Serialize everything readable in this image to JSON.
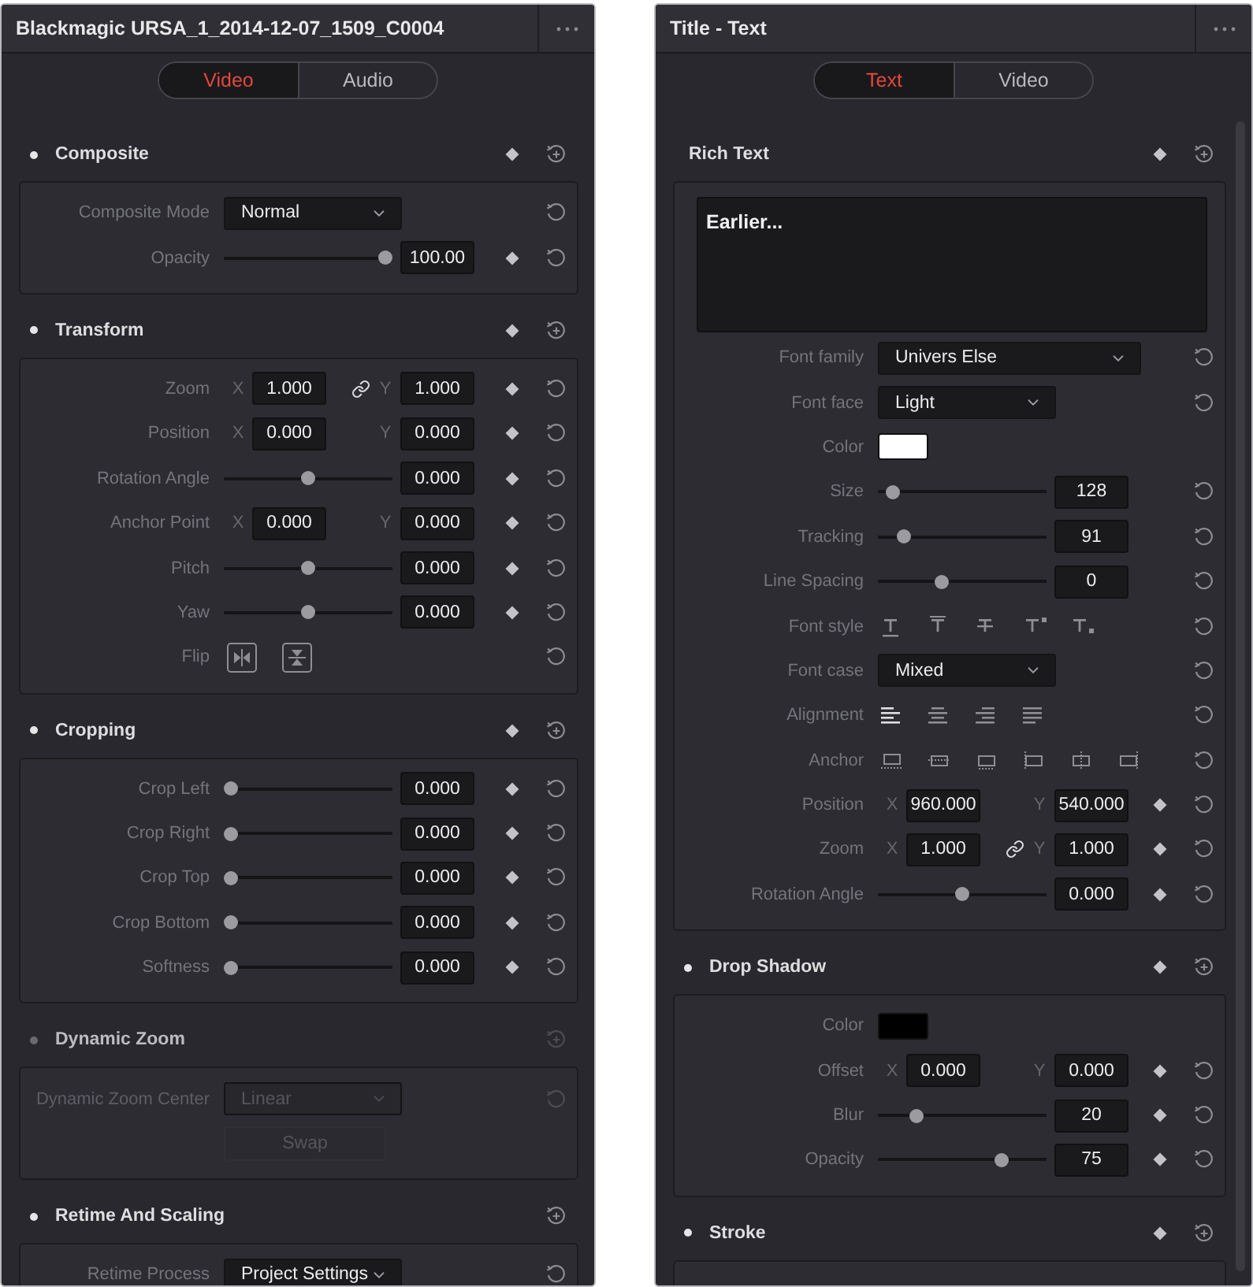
{
  "panels": [
    {
      "title": "Blackmagic URSA_1_2014-12-07_1509_C0004",
      "tabs": [
        {
          "label": "Video",
          "selected": true
        },
        {
          "label": "Audio",
          "selected": false
        }
      ],
      "sections": [
        {
          "title": "Composite",
          "dot": true,
          "enabled": true,
          "keyframe": true,
          "rows": [
            {
              "kind": "dropdown",
              "label": "Composite Mode",
              "value": "Normal",
              "wide": false,
              "keyframe": false,
              "reset": true
            },
            {
              "kind": "slider",
              "label": "Opacity",
              "level": 1,
              "value": "100.00",
              "keyframe": true,
              "reset": true
            }
          ]
        },
        {
          "title": "Transform",
          "dot": true,
          "enabled": true,
          "keyframe": true,
          "rows": [
            {
              "kind": "xy",
              "label": "Zoom",
              "x": {
                "axis": "X",
                "value": "1.000"
              },
              "y": {
                "axis": "Y",
                "value": "1.000"
              },
              "linked": true,
              "keyframe": true,
              "reset": true
            },
            {
              "kind": "xy",
              "label": "Position",
              "x": {
                "axis": "X",
                "value": "0.000"
              },
              "y": {
                "axis": "Y",
                "value": "0.000"
              },
              "linked": false,
              "keyframe": true,
              "reset": true
            },
            {
              "kind": "slider",
              "label": "Rotation Angle",
              "level": 0.5,
              "value": "0.000",
              "keyframe": true,
              "reset": true
            },
            {
              "kind": "xy",
              "label": "Anchor Point",
              "x": {
                "axis": "X",
                "value": "0.000"
              },
              "y": {
                "axis": "Y",
                "value": "0.000"
              },
              "linked": false,
              "keyframe": true,
              "reset": true
            },
            {
              "kind": "slider",
              "label": "Pitch",
              "level": 0.5,
              "value": "0.000",
              "keyframe": true,
              "reset": true
            },
            {
              "kind": "slider",
              "label": "Yaw",
              "level": 0.5,
              "value": "0.000",
              "keyframe": true,
              "reset": true
            },
            {
              "kind": "flip",
              "label": "Flip",
              "keyframe": false,
              "reset": true
            }
          ]
        },
        {
          "title": "Cropping",
          "dot": true,
          "enabled": true,
          "keyframe": true,
          "rows": [
            {
              "kind": "slider",
              "label": "Crop Left",
              "level": 0,
              "value": "0.000",
              "keyframe": true,
              "reset": true
            },
            {
              "kind": "slider",
              "label": "Crop Right",
              "level": 0,
              "value": "0.000",
              "keyframe": true,
              "reset": true
            },
            {
              "kind": "slider",
              "label": "Crop Top",
              "level": 0,
              "value": "0.000",
              "keyframe": true,
              "reset": true
            },
            {
              "kind": "slider",
              "label": "Crop Bottom",
              "level": 0,
              "value": "0.000",
              "keyframe": true,
              "reset": true
            },
            {
              "kind": "slider",
              "label": "Softness",
              "level": 0,
              "value": "0.000",
              "keyframe": true,
              "reset": true
            }
          ]
        },
        {
          "title": "Dynamic Zoom",
          "dot": true,
          "enabled": false,
          "keyframe": false,
          "rows": [
            {
              "kind": "dropdown",
              "label": "Dynamic Zoom Center",
              "value": "Linear",
              "wide": false,
              "keyframe": false,
              "reset": true
            },
            {
              "kind": "button",
              "value": "Swap",
              "keyframe": false,
              "reset": false
            }
          ]
        },
        {
          "title": "Retime And Scaling",
          "dot": true,
          "enabled": true,
          "keyframe": false,
          "rows": [
            {
              "kind": "dropdown",
              "label": "Retime Process",
              "value": "Project Settings",
              "wide": false,
              "keyframe": false,
              "reset": true
            }
          ]
        }
      ]
    },
    {
      "title": "Title - Text",
      "tabs": [
        {
          "label": "Text",
          "selected": true
        },
        {
          "label": "Video",
          "selected": false
        }
      ],
      "sections": [
        {
          "title": "Rich Text",
          "dot": false,
          "enabled": true,
          "keyframe": true,
          "rows": [
            {
              "kind": "textarea",
              "value": "Earlier...",
              "keyframe": false,
              "reset": false
            },
            {
              "kind": "dropdown",
              "label": "Font family",
              "value": "Univers Else",
              "wide": true,
              "keyframe": false,
              "reset": true
            },
            {
              "kind": "dropdown",
              "label": "Font face",
              "value": "Light",
              "wide": false,
              "keyframe": false,
              "reset": true
            },
            {
              "kind": "color",
              "label": "Color",
              "color": "#ffffff",
              "keyframe": false,
              "reset": false
            },
            {
              "kind": "slider",
              "label": "Size",
              "level": 0.05,
              "value": "128",
              "keyframe": false,
              "reset": true
            },
            {
              "kind": "slider",
              "label": "Tracking",
              "level": 0.12,
              "value": "91",
              "keyframe": false,
              "reset": true
            },
            {
              "kind": "slider",
              "label": "Line Spacing",
              "level": 0.37,
              "value": "0",
              "keyframe": false,
              "reset": true
            },
            {
              "kind": "font_style",
              "label": "Font style",
              "keyframe": false,
              "reset": true
            },
            {
              "kind": "dropdown",
              "label": "Font case",
              "value": "Mixed",
              "wide": false,
              "keyframe": false,
              "reset": true
            },
            {
              "kind": "alignment",
              "label": "Alignment",
              "keyframe": false,
              "reset": true
            },
            {
              "kind": "anchor",
              "label": "Anchor",
              "keyframe": false,
              "reset": true
            },
            {
              "kind": "xy",
              "label": "Position",
              "x": {
                "axis": "X",
                "value": "960.000"
              },
              "y": {
                "axis": "Y",
                "value": "540.000"
              },
              "linked": false,
              "keyframe": true,
              "reset": true
            },
            {
              "kind": "xy",
              "label": "Zoom",
              "x": {
                "axis": "X",
                "value": "1.000"
              },
              "y": {
                "axis": "Y",
                "value": "1.000"
              },
              "linked": true,
              "keyframe": true,
              "reset": true
            },
            {
              "kind": "slider",
              "label": "Rotation Angle",
              "level": 0.5,
              "value": "0.000",
              "keyframe": true,
              "reset": true
            }
          ]
        },
        {
          "title": "Drop Shadow",
          "dot": true,
          "enabled": true,
          "keyframe": true,
          "rows": [
            {
              "kind": "color",
              "label": "Color",
              "color": "#000000",
              "keyframe": false,
              "reset": false
            },
            {
              "kind": "xy",
              "label": "Offset",
              "x": {
                "axis": "X",
                "value": "0.000"
              },
              "y": {
                "axis": "Y",
                "value": "0.000"
              },
              "linked": false,
              "keyframe": true,
              "reset": true
            },
            {
              "kind": "slider",
              "label": "Blur",
              "level": 0.2,
              "value": "20",
              "keyframe": true,
              "reset": true
            },
            {
              "kind": "slider",
              "label": "Opacity",
              "level": 0.75,
              "value": "75",
              "keyframe": true,
              "reset": true
            }
          ]
        },
        {
          "title": "Stroke",
          "dot": true,
          "enabled": true,
          "keyframe": true
        }
      ]
    }
  ]
}
